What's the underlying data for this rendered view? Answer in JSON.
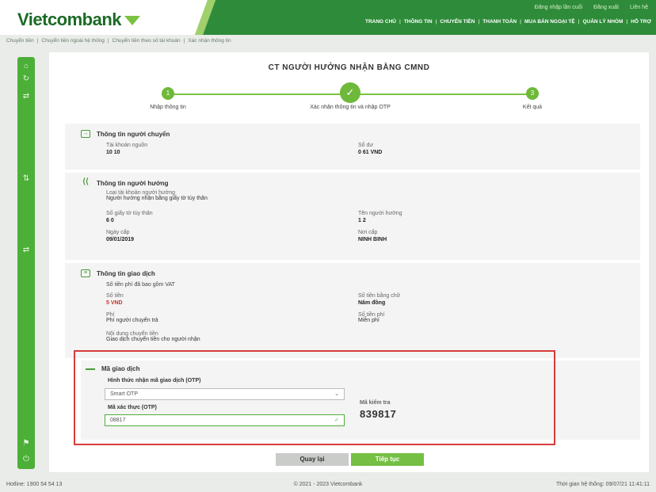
{
  "header": {
    "logo_text": "Vietcombank",
    "top_links": [
      "Đăng nhập lần cuối",
      "Đăng xuất",
      "Liên hệ"
    ],
    "nav": [
      "TRANG CHỦ",
      "THÔNG TIN",
      "CHUYỂN TIỀN",
      "THANH TOÁN",
      "MUA BÁN NGOẠI TỆ",
      "QUẢN LÝ NHÓM",
      "HỖ TRỢ"
    ]
  },
  "breadcrumb": [
    "Chuyển tiền",
    "Chuyển tiền ngoài hệ thống",
    "Chuyển tiền theo số tài khoản",
    "Xác nhận thông tin"
  ],
  "panel": {
    "title": "CT NGƯỜI HƯỞNG NHẬN BẰNG CMND"
  },
  "steps": [
    {
      "num": "1",
      "label": "Nhập thông tin"
    },
    {
      "num": "✓",
      "label": "Xác nhận thông tin và nhập OTP"
    },
    {
      "num": "3",
      "label": "Kết quả"
    }
  ],
  "source": {
    "title": "Thông tin người chuyển",
    "account_label": "Tài khoản nguồn",
    "account_value": "10        10",
    "balance_label": "Số dư",
    "balance_value": "0        61 VND"
  },
  "beneficiary": {
    "title": "Thông tin người hưởng",
    "type_label": "Loại tài khoản người hưởng",
    "type_value": "Người hưởng nhận bằng giấy tờ tùy thân",
    "id_label": "Số giấy tờ tùy thân",
    "id_value": "6        0",
    "name_label": "Tên người hưởng",
    "name_value": "1        2",
    "date_label": "Ngày cấp",
    "date_value": "09/01/2019",
    "place_label": "Nơi cấp",
    "place_value": "NINH BINH"
  },
  "transaction": {
    "title": "Thông tin giao dịch",
    "fee_note": "Số tiền phí đã bao gồm VAT",
    "amount_label": "Số tiền",
    "amount_value": "5 VND",
    "amount_words_label": "Số tiền bằng chữ",
    "amount_words_value": "Năm                    đồng",
    "fee_label": "Phí",
    "fee_value": "Phí người chuyển trả",
    "fee_amount_label": "Số tiền phí",
    "fee_amount_value": "Miễn phí",
    "content_label": "Nội dung chuyển tiền",
    "content_value": "Giao dịch chuyển tiền cho người nhận"
  },
  "otp": {
    "title": "Mã giao dịch",
    "method_label": "Hình thức nhận mã giao dịch (OTP)",
    "method_value": "Smart OTP",
    "otp_label": "Mã xác thực (OTP)",
    "otp_value": "08817",
    "auth_label": "Mã kiểm tra",
    "auth_value": "839817"
  },
  "buttons": {
    "back": "Quay lại",
    "next": "Tiếp tục"
  },
  "footer": {
    "left": "Hotline: 1900 54 54 13",
    "center": "© 2021 - 2023 Vietcombank",
    "right": "Thời gian hệ thống: 09/07/21 11:41:11"
  }
}
